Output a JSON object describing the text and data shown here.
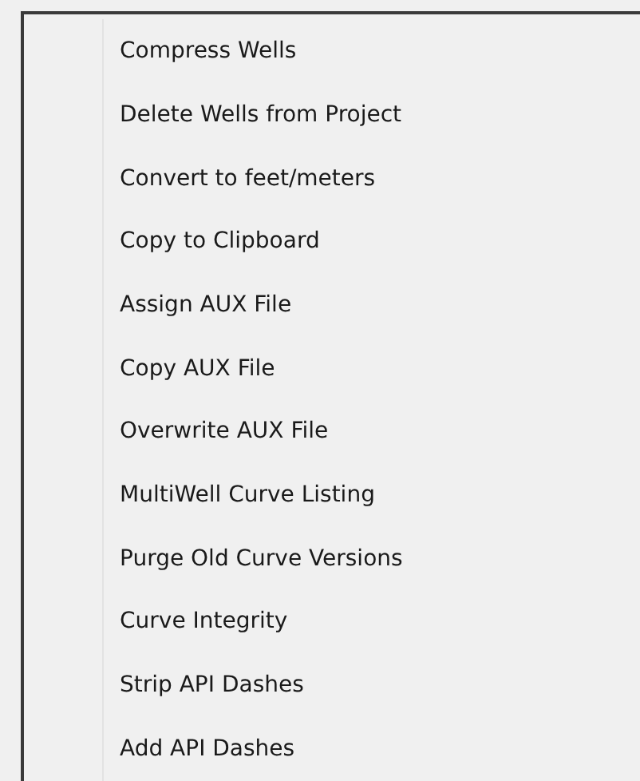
{
  "menu": {
    "items": [
      {
        "label": "Compress Wells"
      },
      {
        "label": "Delete Wells from Project"
      },
      {
        "label": "Convert to feet/meters"
      },
      {
        "label": "Copy to Clipboard"
      },
      {
        "label": "Assign AUX File"
      },
      {
        "label": "Copy AUX File"
      },
      {
        "label": "Overwrite AUX File"
      },
      {
        "label": "MultiWell Curve Listing"
      },
      {
        "label": "Purge Old Curve Versions"
      },
      {
        "label": "Curve Integrity"
      },
      {
        "label": "Strip API Dashes"
      },
      {
        "label": "Add API Dashes"
      }
    ]
  }
}
